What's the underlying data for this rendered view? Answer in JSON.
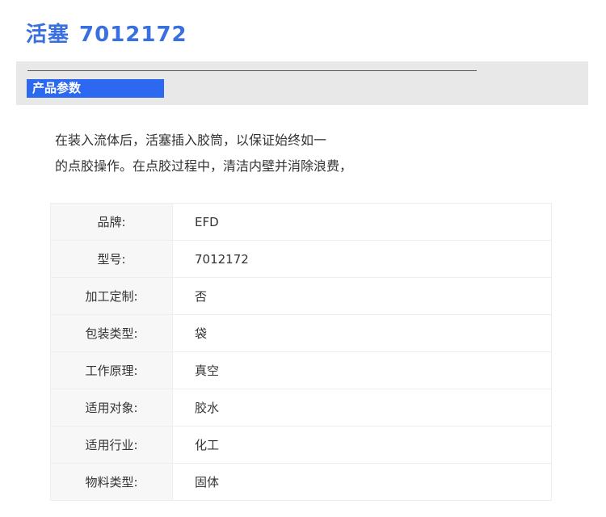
{
  "title": {
    "name": "活塞",
    "code": "7012172"
  },
  "section": {
    "label": "产品参数"
  },
  "intro": {
    "line1": "在装入流体后，活塞插入胶筒，以保证始终如一",
    "line2": "的点胶操作。在点胶过程中，清洁内壁并消除浪费，"
  },
  "specs": [
    {
      "key": "品牌:",
      "value": "EFD"
    },
    {
      "key": "型号:",
      "value": "7012172"
    },
    {
      "key": "加工定制:",
      "value": "否"
    },
    {
      "key": "包装类型:",
      "value": "袋"
    },
    {
      "key": "工作原理:",
      "value": "真空"
    },
    {
      "key": "适用对象:",
      "value": "胶水"
    },
    {
      "key": "适用行业:",
      "value": "化工"
    },
    {
      "key": "物料类型:",
      "value": "固体"
    }
  ],
  "colors": {
    "title": "#3a6fe0",
    "label_bg": "#2d68f0",
    "band_bg": "#e9e8e8"
  }
}
